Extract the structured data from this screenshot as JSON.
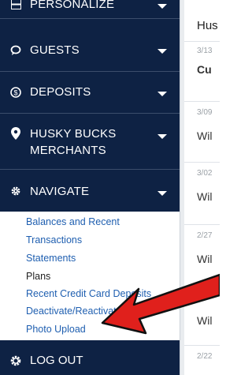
{
  "sidebar": {
    "items": [
      {
        "label": "PERSONALIZE",
        "icon": "grid-icon"
      },
      {
        "label": "GUESTS",
        "icon": "speech-bubble-icon"
      },
      {
        "label": "DEPOSITS",
        "icon": "dollar-circle-icon"
      },
      {
        "label": "HUSKY BUCKS MERCHANTS",
        "line1": "HUSKY BUCKS",
        "line2": "MERCHANTS",
        "icon": "map-pin-icon"
      },
      {
        "label": "NAVIGATE",
        "icon": "gear-icon"
      }
    ],
    "submenu": [
      "Balances and Recent",
      "Transactions",
      "Statements",
      "Plans",
      "Recent Credit Card Deposits",
      "Deactivate/Reactivate",
      "Photo Upload"
    ],
    "logout": "LOG OUT"
  },
  "main": {
    "title": "Hus",
    "rows": [
      {
        "date": "3/13",
        "text": "Cu"
      },
      {
        "date": "3/09",
        "text": "Wil"
      },
      {
        "date": "3/02",
        "text": "Wil"
      },
      {
        "date": "2/27",
        "text": "Wil"
      },
      {
        "date": "",
        "text": "Wil"
      },
      {
        "date": "2/22",
        "text": ""
      }
    ]
  },
  "colors": {
    "sidebar_bg": "#0e2244",
    "link": "#1f5fb0",
    "arrow": "#e0201c"
  }
}
